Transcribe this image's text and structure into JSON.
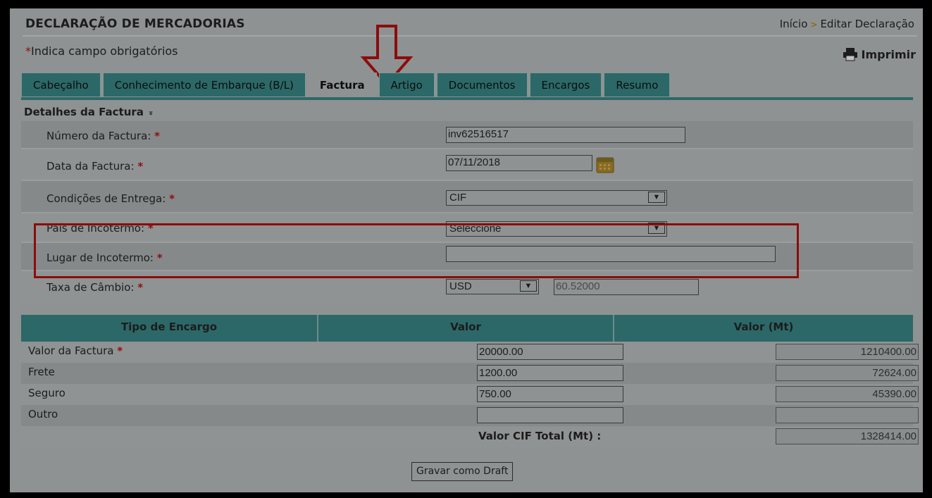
{
  "header": {
    "title": "DECLARAÇÃO DE MERCADORIAS",
    "breadcrumb": [
      "Início",
      "Editar Declaração"
    ]
  },
  "required_note": {
    "star": "*",
    "text": "Indica campo obrigatórios"
  },
  "print_label": "Imprimir",
  "tabs": [
    {
      "label": "Cabeçalho"
    },
    {
      "label": "Conhecimento de Embarque (B/L)"
    },
    {
      "label": "Factura"
    },
    {
      "label": "Artigo"
    },
    {
      "label": "Documentos"
    },
    {
      "label": "Encargos"
    },
    {
      "label": "Resumo"
    }
  ],
  "active_tab": "Factura",
  "section": {
    "title": "Detalhes da Factura",
    "toggle": "»"
  },
  "form": {
    "invoice_number": {
      "label": "Número da Factura:",
      "star": "*",
      "value": "inv62516517"
    },
    "invoice_date": {
      "label": "Data da Factura:",
      "star": "*",
      "value": "07/11/2018"
    },
    "delivery_conditions": {
      "label": "Condições de Entrega:",
      "star": "*",
      "value": "CIF"
    },
    "incoterm_country": {
      "label": "País de Incotermo:",
      "star": "*",
      "value": "Seleccione"
    },
    "incoterm_place": {
      "label": "Lugar de Incotermo:",
      "star": "*",
      "value": ""
    },
    "exchange_rate": {
      "label": "Taxa de Câmbio:",
      "star": "*",
      "currency": "USD",
      "rate": "60.52000"
    }
  },
  "charges_table": {
    "headers": [
      "Tipo de Encargo",
      "Valor",
      "Valor (Mt)"
    ],
    "rows": [
      {
        "label": "Valor da Factura",
        "star": "*",
        "value": "20000.00",
        "mt": "1210400.00"
      },
      {
        "label": "Frete",
        "star": "",
        "value": "1200.00",
        "mt": "72624.00"
      },
      {
        "label": "Seguro",
        "star": "",
        "value": "750.00",
        "mt": "45390.00"
      },
      {
        "label": "Outro",
        "star": "",
        "value": "",
        "mt": ""
      }
    ],
    "total_label": "Valor CIF Total (Mt) :",
    "total_value": "1328414.00"
  },
  "save_draft_label": "Gravar como Draft",
  "colors": {
    "tab": "#2c6868",
    "highlight": "#8c0c0c",
    "required": "#8f0e0e"
  }
}
